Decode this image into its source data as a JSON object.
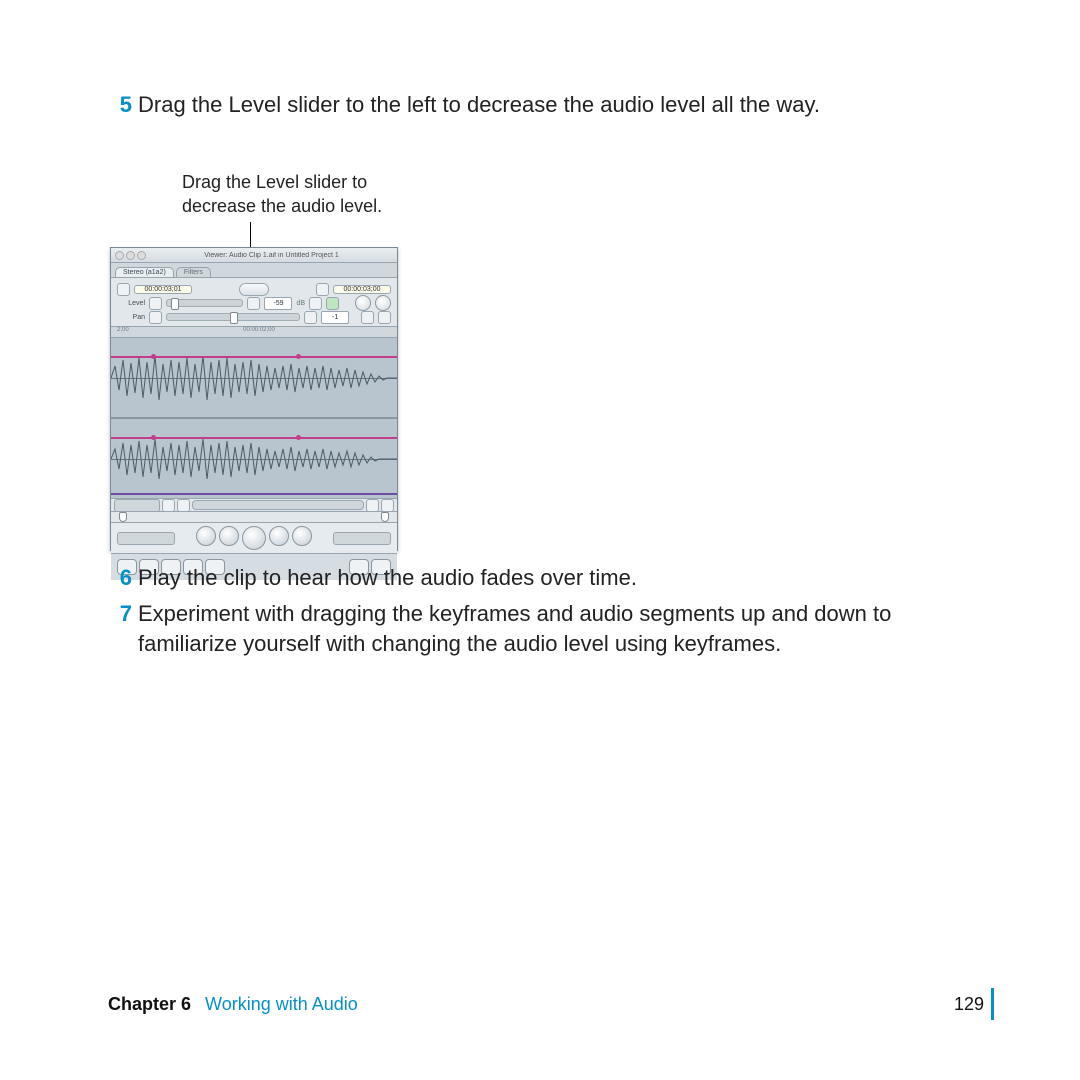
{
  "steps": {
    "s5_num": "5",
    "s5_text": "Drag the Level slider to the left to decrease the audio level all the way.",
    "s6_num": "6",
    "s6_text": "Play the clip to hear how the audio fades over time.",
    "s7_num": "7",
    "s7_text": "Experiment with dragging the keyframes and audio segments up and down to familiarize yourself with changing the audio level using keyframes."
  },
  "callout": {
    "text_line1": "Drag the Level slider to",
    "text_line2": "decrease the audio level."
  },
  "viewer": {
    "window_title": "Viewer: Audio Clip 1.aif in Untitled Project 1",
    "tab_active": "Stereo (a1a2)",
    "tab_inactive": "Filters",
    "tc_left": "00:00:03;01",
    "tc_right": "00:00:03;00",
    "level_label": "Level",
    "level_value": "-59",
    "level_unit": "dB",
    "pan_label": "Pan",
    "pan_value": "-1",
    "ruler_left": "2;00",
    "ruler_mid": "00:00:02;00"
  },
  "footer": {
    "chapter_label": "Chapter 6",
    "chapter_title": "Working with Audio",
    "page_number": "129"
  }
}
